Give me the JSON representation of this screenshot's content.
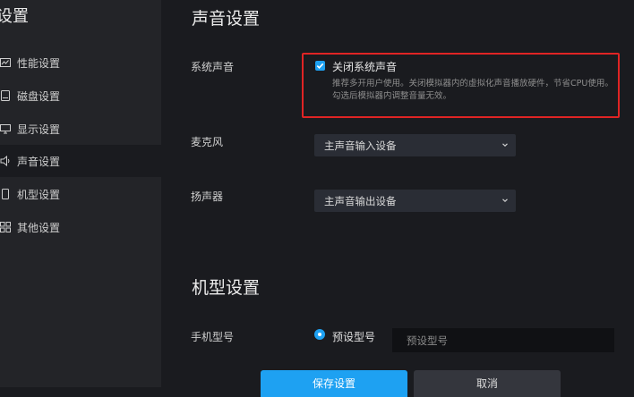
{
  "sidebar": {
    "title": "设置",
    "items": [
      {
        "label": "性能设置",
        "icon": "chart-icon"
      },
      {
        "label": "磁盘设置",
        "icon": "disk-icon"
      },
      {
        "label": "显示设置",
        "icon": "monitor-icon"
      },
      {
        "label": "声音设置",
        "icon": "speaker-icon",
        "active": true
      },
      {
        "label": "机型设置",
        "icon": "phone-icon"
      },
      {
        "label": "其他设置",
        "icon": "grid-icon"
      }
    ]
  },
  "sound": {
    "title": "声音设置",
    "system_sound_label": "系统声音",
    "mute_checkbox_label": "关闭系统声音",
    "mute_checked": true,
    "mute_description": "推荐多开用户使用。关闭模拟器内的虚拟化声音播放硬件，节省CPU使用。勾选后模拟器内调整音量无效。",
    "mic_label": "麦克风",
    "mic_value": "主声音输入设备",
    "speaker_label": "扬声器",
    "speaker_value": "主声音输出设备"
  },
  "model": {
    "title": "机型设置",
    "phone_model_label": "手机型号",
    "preset_radio_label": "预设型号",
    "preset_input_placeholder": "预设型号"
  },
  "actions": {
    "save_label": "保存设置",
    "cancel_label": "取消"
  },
  "colors": {
    "accent": "#1ea1f2",
    "highlight_border": "#e02424",
    "background": "#1a1b1f",
    "sidebar_bg": "#232428"
  }
}
